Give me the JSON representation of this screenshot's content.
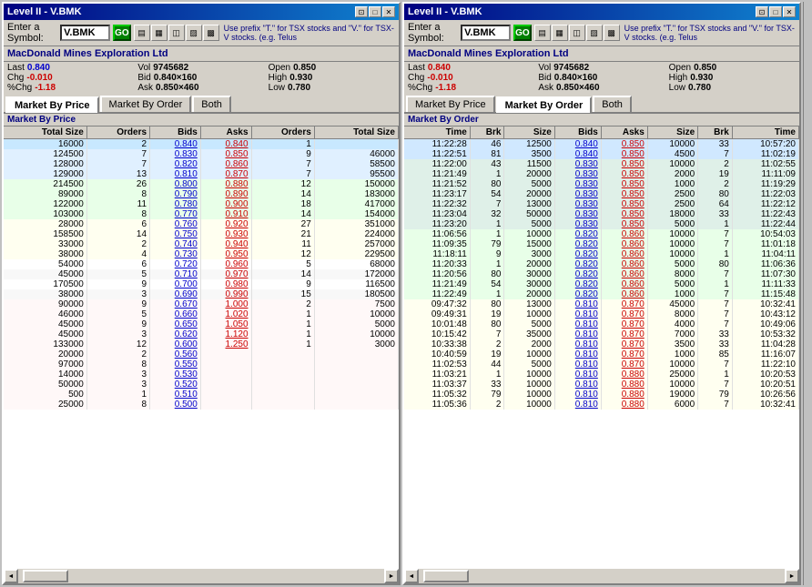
{
  "windows": [
    {
      "id": "left",
      "title": "Level II - V.BMK",
      "symbol": "V.BMK",
      "goLabel": "GO",
      "hint": "Use prefix \"T.\" for TSX stocks and \"V.\" for TSX-V stocks. (e.g. Telus",
      "companyName": "MacDonald Mines Exploration Ltd",
      "stockInfo": {
        "last": "0.840",
        "vol": "9745682",
        "open": "0.850",
        "chg": "-0.010",
        "bid": "0.840×160",
        "high": "0.930",
        "pctChg": "-1.18",
        "ask": "0.850×460",
        "low": "0.780"
      },
      "tabs": [
        "Market By Price",
        "Market By Order",
        "Both"
      ],
      "activeTab": 0,
      "marketByPrice": {
        "sectionTitle": "Market By Price",
        "headers": [
          "Total Size",
          "Orders",
          "Bids",
          "Asks",
          "Orders",
          "Total Size"
        ],
        "rows": [
          [
            "16000",
            "2",
            "0.840",
            "0.840",
            "1",
            ""
          ],
          [
            "124500",
            "7",
            "0.830",
            "0.850",
            "9",
            "46000"
          ],
          [
            "128000",
            "7",
            "0.820",
            "0.860",
            "7",
            "58500"
          ],
          [
            "129000",
            "13",
            "0.810",
            "0.870",
            "7",
            "95500"
          ],
          [
            "214500",
            "26",
            "0.800",
            "0.880",
            "12",
            "150000"
          ],
          [
            "89000",
            "8",
            "0.790",
            "0.890",
            "14",
            "183000"
          ],
          [
            "122000",
            "11",
            "0.780",
            "0.900",
            "18",
            "417000"
          ],
          [
            "103000",
            "8",
            "0.770",
            "0.910",
            "14",
            "154000"
          ],
          [
            "28000",
            "6",
            "0.760",
            "0.920",
            "27",
            "351000"
          ],
          [
            "158500",
            "14",
            "0.750",
            "0.930",
            "21",
            "224000"
          ],
          [
            "33000",
            "2",
            "0.740",
            "0.940",
            "11",
            "257000"
          ],
          [
            "38000",
            "4",
            "0.730",
            "0.950",
            "12",
            "229500"
          ],
          [
            "54000",
            "6",
            "0.720",
            "0.960",
            "5",
            "68000"
          ],
          [
            "45000",
            "5",
            "0.710",
            "0.970",
            "14",
            "172000"
          ],
          [
            "170500",
            "9",
            "0.700",
            "0.980",
            "9",
            "116500"
          ],
          [
            "38000",
            "3",
            "0.690",
            "0.990",
            "15",
            "180500"
          ],
          [
            "90000",
            "9",
            "0.670",
            "1.000",
            "2",
            "7500"
          ],
          [
            "46000",
            "5",
            "0.660",
            "1.020",
            "1",
            "10000"
          ],
          [
            "45000",
            "9",
            "0.650",
            "1.050",
            "1",
            "5000"
          ],
          [
            "45000",
            "3",
            "0.620",
            "1.120",
            "1",
            "10000"
          ],
          [
            "133000",
            "12",
            "0.600",
            "1.250",
            "1",
            "3000"
          ],
          [
            "20000",
            "2",
            "0.560",
            "",
            "",
            ""
          ],
          [
            "97000",
            "8",
            "0.550",
            "",
            "",
            ""
          ],
          [
            "14000",
            "3",
            "0.530",
            "",
            "",
            ""
          ],
          [
            "50000",
            "3",
            "0.520",
            "",
            "",
            ""
          ],
          [
            "500",
            "1",
            "0.510",
            "",
            "",
            ""
          ],
          [
            "25000",
            "8",
            "0.500",
            "",
            "",
            ""
          ]
        ]
      }
    },
    {
      "id": "right",
      "title": "Level II - V.BMK",
      "symbol": "V.BMK",
      "goLabel": "GO",
      "hint": "Use prefix \"T.\" for TSX stocks and \"V.\" for TSX-V stocks. (e.g. Telus",
      "companyName": "MacDonald Mines Exploration Ltd",
      "stockInfo": {
        "last": "0.840",
        "vol": "9745682",
        "open": "0.850",
        "chg": "-0.010",
        "bid": "0.840×160",
        "high": "0.930",
        "pctChg": "-1.18",
        "ask": "0.850×460",
        "low": "0.780"
      },
      "tabs": [
        "Market By Price",
        "Market By Order",
        "Both"
      ],
      "activeTab": 1,
      "marketByOrder": {
        "sectionTitle": "Market By Order",
        "headers": [
          "Time",
          "Brk",
          "Size",
          "Bids",
          "Asks",
          "Size",
          "Brk",
          "Time"
        ],
        "rows": [
          [
            "11:22:28",
            "46",
            "12500",
            "0.840",
            "0.850",
            "10000",
            "33",
            "10:57:20"
          ],
          [
            "11:22:51",
            "81",
            "3500",
            "0.840",
            "0.850",
            "4500",
            "7",
            "11:02:19"
          ],
          [
            "11:22:00",
            "43",
            "11500",
            "0.830",
            "0.850",
            "10000",
            "2",
            "11:02:55"
          ],
          [
            "11:21:49",
            "1",
            "20000",
            "0.830",
            "0.850",
            "2000",
            "19",
            "11:11:09"
          ],
          [
            "11:21:52",
            "80",
            "5000",
            "0.830",
            "0.850",
            "1000",
            "2",
            "11:19:29"
          ],
          [
            "11:23:17",
            "54",
            "20000",
            "0.830",
            "0.850",
            "2500",
            "80",
            "11:22:03"
          ],
          [
            "11:22:32",
            "7",
            "13000",
            "0.830",
            "0.850",
            "2500",
            "64",
            "11:22:12"
          ],
          [
            "11:23:04",
            "32",
            "50000",
            "0.830",
            "0.850",
            "18000",
            "33",
            "11:22:43"
          ],
          [
            "11:23:20",
            "1",
            "5000",
            "0.830",
            "0.850",
            "5000",
            "1",
            "11:22:44"
          ],
          [
            "11:06:56",
            "1",
            "10000",
            "0.820",
            "0.860",
            "10000",
            "7",
            "10:54:03"
          ],
          [
            "11:09:35",
            "79",
            "15000",
            "0.820",
            "0.860",
            "10000",
            "7",
            "11:01:18"
          ],
          [
            "11:18:11",
            "9",
            "3000",
            "0.820",
            "0.860",
            "10000",
            "1",
            "11:04:11"
          ],
          [
            "11:20:33",
            "1",
            "20000",
            "0.820",
            "0.860",
            "5000",
            "80",
            "11:06:36"
          ],
          [
            "11:20:56",
            "80",
            "30000",
            "0.820",
            "0.860",
            "8000",
            "7",
            "11:07:30"
          ],
          [
            "11:21:49",
            "54",
            "30000",
            "0.820",
            "0.860",
            "5000",
            "1",
            "11:11:33"
          ],
          [
            "11:22:49",
            "1",
            "20000",
            "0.820",
            "0.860",
            "1000",
            "7",
            "11:15:48"
          ],
          [
            "09:47:32",
            "80",
            "13000",
            "0.810",
            "0.870",
            "45000",
            "7",
            "10:32:41"
          ],
          [
            "09:49:31",
            "19",
            "10000",
            "0.810",
            "0.870",
            "8000",
            "7",
            "10:43:12"
          ],
          [
            "10:01:48",
            "80",
            "5000",
            "0.810",
            "0.870",
            "4000",
            "7",
            "10:49:06"
          ],
          [
            "10:15:42",
            "7",
            "35000",
            "0.810",
            "0.870",
            "7000",
            "33",
            "10:53:32"
          ],
          [
            "10:33:38",
            "2",
            "2000",
            "0.810",
            "0.870",
            "3500",
            "33",
            "11:04:28"
          ],
          [
            "10:40:59",
            "19",
            "10000",
            "0.810",
            "0.870",
            "1000",
            "85",
            "11:16:07"
          ],
          [
            "11:02:53",
            "44",
            "5000",
            "0.810",
            "0.870",
            "10000",
            "7",
            "11:22:10"
          ],
          [
            "11:03:21",
            "1",
            "10000",
            "0.810",
            "0.880",
            "25000",
            "1",
            "10:20:53"
          ],
          [
            "11:03:37",
            "33",
            "10000",
            "0.810",
            "0.880",
            "10000",
            "7",
            "10:20:51"
          ],
          [
            "11:05:32",
            "79",
            "10000",
            "0.810",
            "0.880",
            "19000",
            "79",
            "10:26:56"
          ],
          [
            "11:05:36",
            "2",
            "10000",
            "0.810",
            "0.880",
            "6000",
            "7",
            "10:32:41"
          ]
        ]
      }
    }
  ],
  "icons": {
    "minimize": "─",
    "maximize": "□",
    "close": "✕",
    "arrow_up": "▲",
    "arrow_down": "▼",
    "arrow_left": "◄",
    "arrow_right": "►"
  },
  "colors": {
    "titlebar_start": "#000080",
    "titlebar_end": "#1084d0",
    "bid": "#0000cc",
    "ask": "#cc0000",
    "chg_neg": "#cc0000",
    "last_blue": "#0000cc"
  }
}
